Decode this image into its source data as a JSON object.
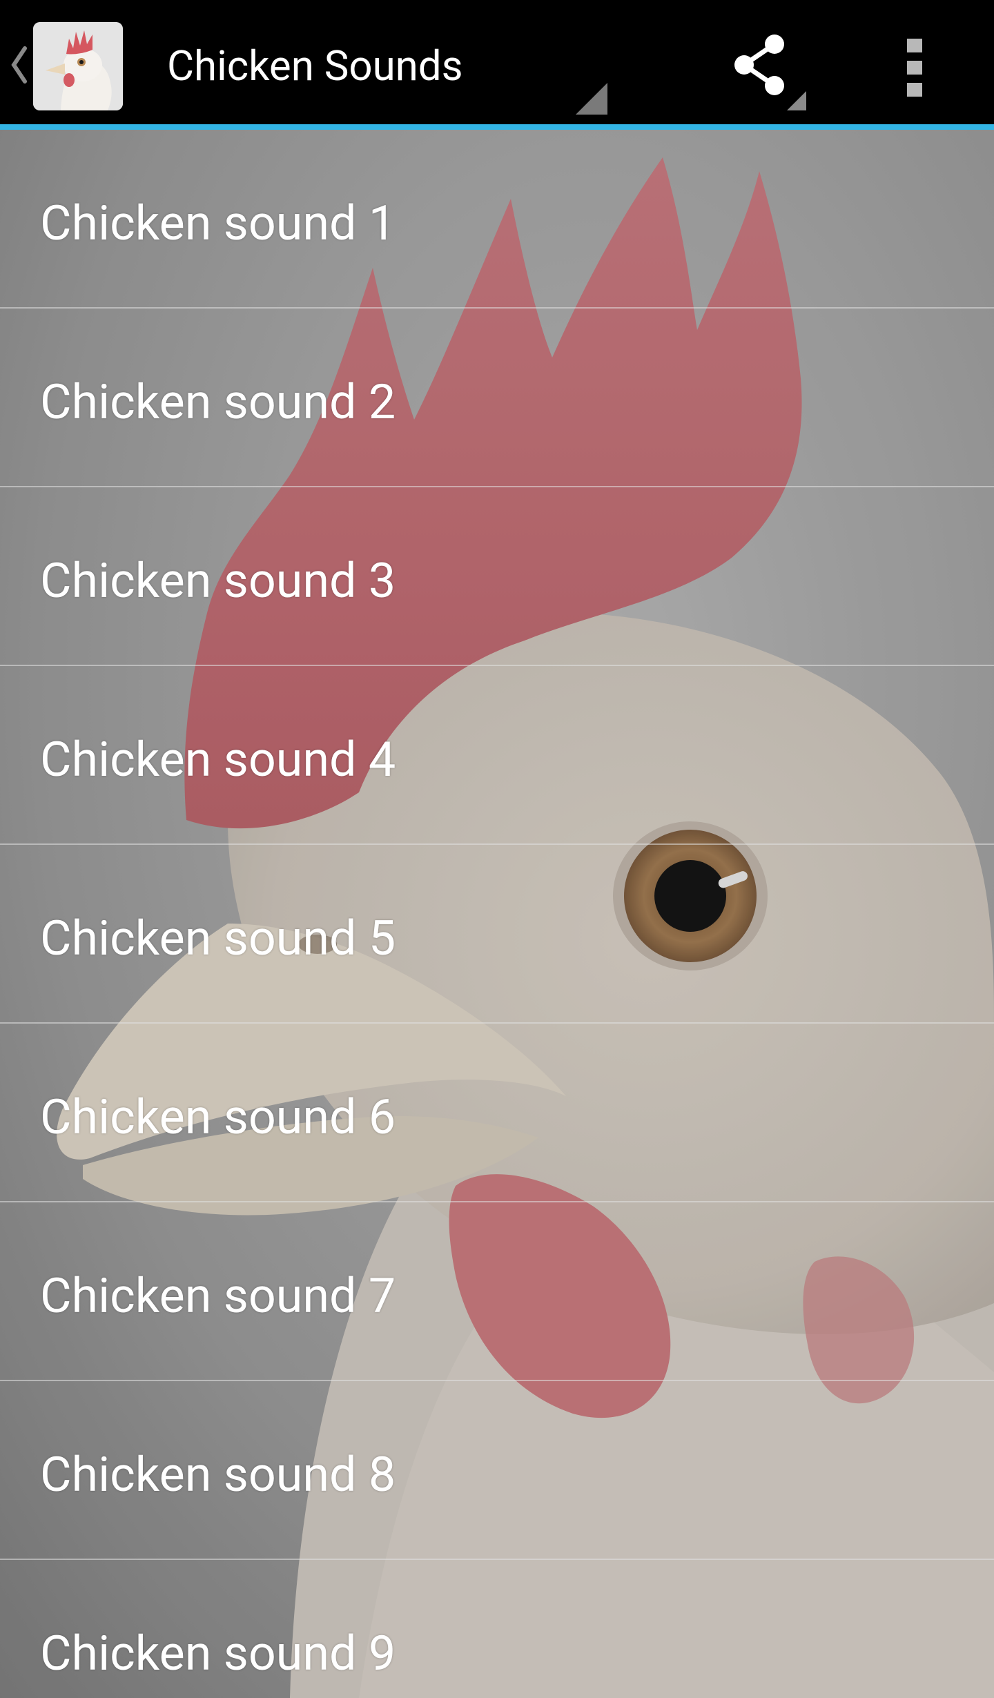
{
  "action_bar": {
    "title": "Chicken Sounds",
    "up_icon": "chevron-left-icon",
    "share_icon": "share-icon",
    "overflow_icon": "more-vert-icon",
    "accent_color": "#33b5e5",
    "background_color": "#000000"
  },
  "sound_list": {
    "items": [
      {
        "label": "Chicken sound 1"
      },
      {
        "label": "Chicken sound 2"
      },
      {
        "label": "Chicken sound 3"
      },
      {
        "label": "Chicken sound 4"
      },
      {
        "label": "Chicken sound 5"
      },
      {
        "label": "Chicken sound 6"
      },
      {
        "label": "Chicken sound 7"
      },
      {
        "label": "Chicken sound 8"
      },
      {
        "label": "Chicken sound 9"
      }
    ],
    "text_color": "#ffffff",
    "divider_color": "#dcdcdc"
  },
  "background": {
    "subject": "white chicken head with red comb",
    "backdrop_color": "#8f8f8f",
    "comb_color": "#c96a72",
    "feather_color": "#d8d2cc"
  }
}
